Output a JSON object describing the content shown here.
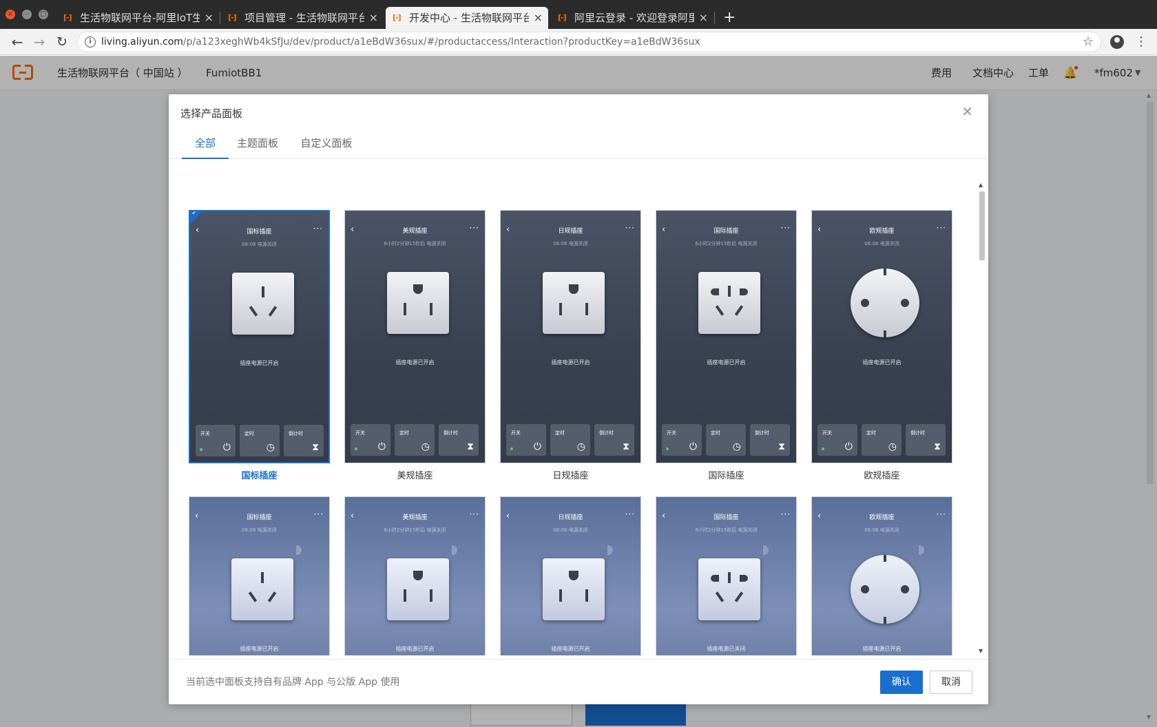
{
  "browser": {
    "tabs": [
      {
        "title": "生活物联网平台-阿里IoT生",
        "active": false
      },
      {
        "title": "项目管理 - 生活物联网平台",
        "active": false
      },
      {
        "title": "开发中心 - 生活物联网平台",
        "active": true
      },
      {
        "title": "阿里云登录 - 欢迎登录阿里",
        "active": false
      }
    ],
    "new_tab": "+",
    "url_host": "living.aliyun.com",
    "url_path": "/p/a123xeghWb4kSfJu/dev/product/a1eBdW36sux/#/productaccess/Interaction?productKey=a1eBdW36sux"
  },
  "topnav": {
    "platform": "生活物联网平台（ 中国站 ）",
    "project": "FumiotBB1",
    "links": [
      "费用",
      "文档中心",
      "工单"
    ],
    "user": "*fm602"
  },
  "dialog": {
    "title": "选择产品面板",
    "tabs": [
      "全部",
      "主题面板",
      "自定义面板"
    ],
    "active_tab": "全部",
    "buttons": [
      "开关",
      "定时",
      "倒计时"
    ],
    "panels": [
      {
        "label": "国标插座",
        "screen_title": "国标插座",
        "subtitle": "06:08 电源关闭",
        "status": "插座电源已开启",
        "socket": "cn",
        "theme": "dark",
        "selected": true
      },
      {
        "label": "美规插座",
        "screen_title": "美规插座",
        "subtitle": "6小时2分钟15秒后 电源关闭",
        "status": "插座电源已开启",
        "socket": "us",
        "theme": "dark",
        "selected": false
      },
      {
        "label": "日规插座",
        "screen_title": "日规插座",
        "subtitle": "06:08 电源关闭",
        "status": "插座电源已开启",
        "socket": "jp",
        "theme": "dark",
        "selected": false
      },
      {
        "label": "国际插座",
        "screen_title": "国际插座",
        "subtitle": "6小时2分钟15秒后 电源关闭",
        "status": "插座电源已开启",
        "socket": "intl",
        "theme": "dark",
        "selected": false
      },
      {
        "label": "欧规插座",
        "screen_title": "欧规插座",
        "subtitle": "06:08 电源关闭",
        "status": "插座电源已开启",
        "socket": "eu",
        "theme": "dark",
        "selected": false
      },
      {
        "label": "",
        "screen_title": "国标插座",
        "subtitle": "06:08 电源关闭",
        "status": "插座电源已开启",
        "socket": "cn",
        "theme": "light",
        "selected": false
      },
      {
        "label": "",
        "screen_title": "美规插座",
        "subtitle": "6小时2分钟15秒后 电源关闭",
        "status": "插座电源已开启",
        "socket": "us",
        "theme": "light",
        "selected": false
      },
      {
        "label": "",
        "screen_title": "日规插座",
        "subtitle": "06:08 电源关闭",
        "status": "插座电源已开启",
        "socket": "jp",
        "theme": "light",
        "selected": false
      },
      {
        "label": "",
        "screen_title": "国际插座",
        "subtitle": "6小时2分钟15秒后 电源关闭",
        "status": "插座电源已关闭",
        "socket": "intl",
        "theme": "light",
        "selected": false
      },
      {
        "label": "",
        "screen_title": "欧规插座",
        "subtitle": "06:08 电源关闭",
        "status": "插座电源已开启",
        "socket": "eu",
        "theme": "light",
        "selected": false
      }
    ],
    "footer_note": "当前选中面板支持自有品牌 App 与公版 App 使用",
    "confirm": "确认",
    "cancel": "取消"
  },
  "colors": {
    "accent": "#1a6fce",
    "brand": "#ff6a00",
    "power_dot": "#3ddc55"
  }
}
